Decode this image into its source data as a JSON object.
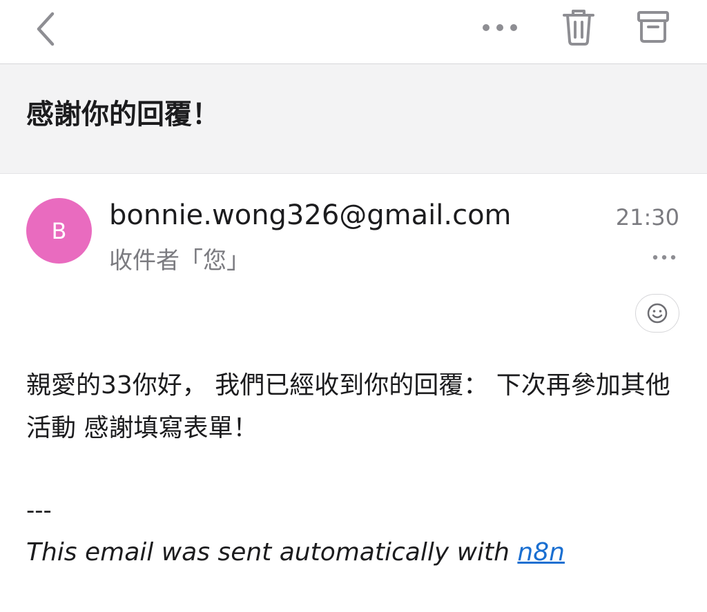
{
  "toolbar": {
    "back_icon": "chevron-left-icon",
    "more_icon": "ellipsis-icon",
    "trash_icon": "trash-icon",
    "archive_icon": "archive-icon",
    "icon_color": "#8e8e93"
  },
  "email": {
    "subject": "感謝你的回覆！",
    "sender": {
      "avatar_initial": "B",
      "avatar_color": "#e96bbf",
      "address": "bonnie.wong326@gmail.com"
    },
    "recipient_line": "收件者「您」",
    "time": "21:30",
    "body": "親愛的33你好， 我們已經收到你的回覆： 下次再參加其他活動 感謝填寫表單！",
    "divider": "---",
    "footer_prefix": "This email was sent automatically with ",
    "footer_link_text": "n8n",
    "link_color": "#1a6fd1"
  }
}
